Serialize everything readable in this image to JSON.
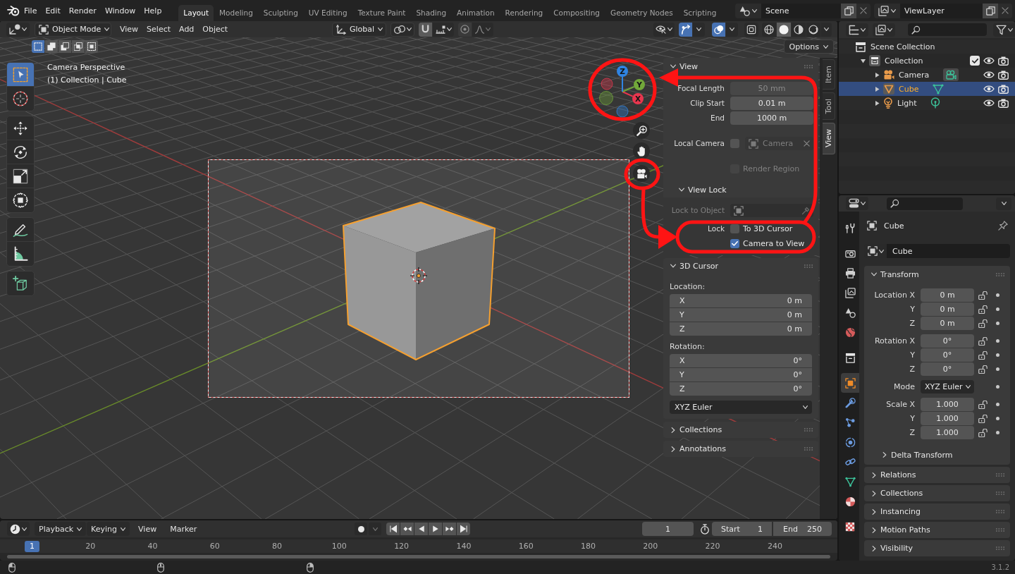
{
  "top_bar": {
    "menus": [
      "File",
      "Edit",
      "Render",
      "Window",
      "Help"
    ],
    "workspaces": [
      {
        "label": "Layout",
        "selected": true
      },
      {
        "label": "Modeling",
        "selected": false
      },
      {
        "label": "Sculpting",
        "selected": false
      },
      {
        "label": "UV Editing",
        "selected": false
      },
      {
        "label": "Texture Paint",
        "selected": false
      },
      {
        "label": "Shading",
        "selected": false
      },
      {
        "label": "Animation",
        "selected": false
      },
      {
        "label": "Rendering",
        "selected": false
      },
      {
        "label": "Compositing",
        "selected": false
      },
      {
        "label": "Geometry Nodes",
        "selected": false
      },
      {
        "label": "Scripting",
        "selected": false
      }
    ],
    "scene": "Scene",
    "view_layer": "ViewLayer"
  },
  "viewport_header": {
    "mode": "Object Mode",
    "menus": [
      "View",
      "Select",
      "Add",
      "Object"
    ],
    "orientation": "Global",
    "toggles": [
      {
        "kind": "snap",
        "on": true
      },
      {
        "kind": "proportional",
        "on": false
      },
      {
        "kind": "gizmos",
        "on": true
      },
      {
        "kind": "overlays",
        "on": true
      },
      {
        "kind": "xray",
        "on": false
      }
    ],
    "shading": [
      {
        "kind": "wireframe",
        "selected": false
      },
      {
        "kind": "solid",
        "selected": true
      },
      {
        "kind": "material",
        "selected": false
      },
      {
        "kind": "rendered",
        "selected": false
      }
    ],
    "select_modes": [
      {
        "kind": "set",
        "selected": true
      },
      {
        "kind": "extend",
        "selected": false
      },
      {
        "kind": "subtract",
        "selected": false
      },
      {
        "kind": "invert",
        "selected": false
      },
      {
        "kind": "intersect",
        "selected": false
      }
    ],
    "options": "Options"
  },
  "toolbar": [
    {
      "tools": [
        {
          "kind": "select",
          "selected": true
        },
        {
          "kind": "cursor",
          "selected": false
        }
      ]
    },
    {
      "tools": [
        {
          "kind": "move",
          "selected": false
        },
        {
          "kind": "rotate",
          "selected": false
        },
        {
          "kind": "scale",
          "selected": false
        },
        {
          "kind": "transform",
          "selected": false
        }
      ]
    },
    {
      "tools": [
        {
          "kind": "annotate",
          "selected": false
        },
        {
          "kind": "measure",
          "selected": false
        }
      ]
    },
    {
      "tools": [
        {
          "kind": "primitive",
          "selected": false
        }
      ]
    }
  ],
  "viewport": {
    "view_name": "Camera Perspective",
    "context": "(1) Collection | Cube",
    "nav_gizmo": {
      "axes": [
        {
          "label": "X",
          "color": "#e8364e"
        },
        {
          "label": "Y",
          "color": "#72a83a"
        },
        {
          "label": "Z",
          "color": "#2f84e3"
        }
      ]
    }
  },
  "sidebar": {
    "panels": [
      {
        "kind": "view",
        "title": "View",
        "expanded": true,
        "rows": [
          {
            "kind": "field",
            "label": "Focal Length",
            "value": "50 mm",
            "disabled": true
          },
          {
            "kind": "field",
            "label": "Clip Start",
            "value": "0.01 m",
            "disabled": false
          },
          {
            "kind": "field",
            "label": "End",
            "value": "1000 m",
            "disabled": false
          },
          {
            "kind": "camera",
            "label": "Local Camera",
            "checked": false,
            "value": "Camera",
            "disabled": true
          },
          {
            "kind": "check",
            "label": "Render Region",
            "checked": false,
            "disabled": true
          }
        ],
        "subpanel": {
          "title": "View Lock",
          "expanded": true,
          "rows": [
            {
              "kind": "object",
              "label": "Lock to Object",
              "disabled": true
            },
            {
              "kind": "check",
              "side_label": "Lock",
              "label": "To 3D Cursor",
              "checked": false,
              "disabled": false
            },
            {
              "kind": "check",
              "label": "Camera to View",
              "checked": true,
              "disabled": false
            }
          ]
        }
      },
      {
        "kind": "cursor",
        "title": "3D Cursor",
        "expanded": true,
        "groups": [
          {
            "label": "Location:",
            "fields": [
              {
                "axis": "X",
                "value": "0 m"
              },
              {
                "axis": "Y",
                "value": "0 m"
              },
              {
                "axis": "Z",
                "value": "0 m"
              }
            ]
          },
          {
            "label": "Rotation:",
            "fields": [
              {
                "axis": "X",
                "value": "0°"
              },
              {
                "axis": "Y",
                "value": "0°"
              },
              {
                "axis": "Z",
                "value": "0°"
              }
            ]
          }
        ],
        "mode": "XYZ Euler"
      },
      {
        "kind": "plain",
        "title": "Collections",
        "expanded": false
      },
      {
        "kind": "plain",
        "title": "Annotations",
        "expanded": false
      }
    ],
    "tabs": [
      {
        "label": "Item",
        "selected": false
      },
      {
        "label": "Tool",
        "selected": false
      },
      {
        "label": "View",
        "selected": true
      }
    ]
  },
  "outliner": {
    "items": [
      {
        "kind": "scene",
        "label": "Scene Collection",
        "selected": false,
        "children": [
          {
            "kind": "collection",
            "label": "Collection",
            "selected": false,
            "expanded": true,
            "checked": true,
            "children": [
              {
                "kind": "camera",
                "label": "Camera",
                "selected": false,
                "expanded": false
              },
              {
                "kind": "mesh",
                "label": "Cube",
                "selected": true,
                "expanded": false
              },
              {
                "kind": "light",
                "label": "Light",
                "selected": false,
                "expanded": false
              }
            ]
          }
        ]
      }
    ]
  },
  "properties": {
    "tabs": [
      [
        {
          "kind": "tool",
          "selected": false
        }
      ],
      [
        {
          "kind": "render",
          "selected": false
        },
        {
          "kind": "output",
          "selected": false
        },
        {
          "kind": "viewlayer",
          "selected": false
        },
        {
          "kind": "scene",
          "selected": false
        },
        {
          "kind": "world",
          "selected": false
        }
      ],
      [
        {
          "kind": "collection",
          "selected": false
        }
      ],
      [
        {
          "kind": "object",
          "selected": true
        },
        {
          "kind": "modifiers",
          "selected": false
        },
        {
          "kind": "particles",
          "selected": false
        },
        {
          "kind": "physics",
          "selected": false
        },
        {
          "kind": "constraints",
          "selected": false
        },
        {
          "kind": "data",
          "selected": false
        },
        {
          "kind": "material",
          "selected": false
        }
      ],
      [
        {
          "kind": "texture",
          "selected": false
        }
      ]
    ],
    "title": "Cube",
    "name": "Cube",
    "panels": [
      {
        "kind": "transform",
        "title": "Transform",
        "expanded": true,
        "groups": [
          {
            "rows": [
              {
                "kind": "field",
                "label": "Location X",
                "value": "0 m",
                "locked": false
              },
              {
                "kind": "field",
                "label": "Y",
                "value": "0 m",
                "locked": false
              },
              {
                "kind": "field",
                "label": "Z",
                "value": "0 m",
                "locked": false
              }
            ]
          },
          {
            "rows": [
              {
                "kind": "field",
                "label": "Rotation X",
                "value": "0°",
                "locked": false
              },
              {
                "kind": "field",
                "label": "Y",
                "value": "0°",
                "locked": false
              },
              {
                "kind": "field",
                "label": "Z",
                "value": "0°",
                "locked": false
              }
            ]
          },
          {
            "rows": [
              {
                "kind": "dropdown",
                "label": "Mode",
                "value": "XYZ Euler"
              }
            ]
          },
          {
            "rows": [
              {
                "kind": "field",
                "label": "Scale X",
                "value": "1.000",
                "locked": false
              },
              {
                "kind": "field",
                "label": "Y",
                "value": "1.000",
                "locked": false
              },
              {
                "kind": "field",
                "label": "Z",
                "value": "1.000",
                "locked": false
              }
            ]
          }
        ],
        "subpanel": {
          "title": "Delta Transform",
          "expanded": false
        }
      },
      {
        "kind": "plain",
        "title": "Relations",
        "expanded": false
      },
      {
        "kind": "plain",
        "title": "Collections",
        "expanded": false
      },
      {
        "kind": "plain",
        "title": "Instancing",
        "expanded": false
      },
      {
        "kind": "plain",
        "title": "Motion Paths",
        "expanded": false
      },
      {
        "kind": "plain",
        "title": "Visibility",
        "expanded": false
      }
    ]
  },
  "timeline": {
    "menus": [
      {
        "kind": "dropdown",
        "label": "Playback"
      },
      {
        "kind": "dropdown",
        "label": "Keying"
      },
      {
        "kind": "menu",
        "label": "View"
      },
      {
        "kind": "menu",
        "label": "Marker"
      }
    ],
    "current_frame": "1",
    "start_label": "Start",
    "start": "1",
    "end_label": "End",
    "end": "250",
    "playhead": "1",
    "ticks": [
      "20",
      "40",
      "60",
      "80",
      "100",
      "120",
      "140",
      "160",
      "180",
      "200",
      "220",
      "240"
    ]
  },
  "status_bar": {
    "version": "3.1.2"
  }
}
